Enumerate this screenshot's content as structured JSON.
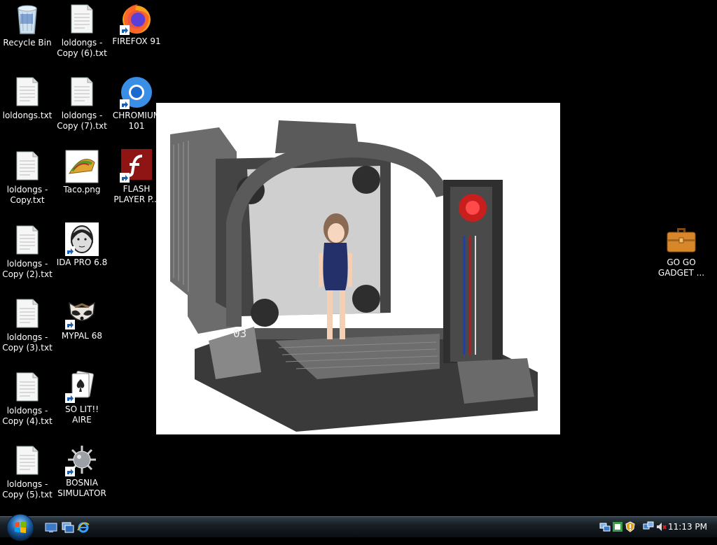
{
  "desktop_icons": [
    {
      "id": "recycle-bin",
      "label": "Recycle Bin",
      "icon": "recycle-bin-icon",
      "shortcut": false
    },
    {
      "id": "loldongs-copy6",
      "label": "loldongs -\nCopy (6).txt",
      "icon": "text-file-icon",
      "shortcut": false
    },
    {
      "id": "firefox",
      "label": "FIREFOX 91",
      "icon": "firefox-icon",
      "shortcut": true
    },
    {
      "id": "loldongs",
      "label": "loldongs.txt",
      "icon": "text-file-icon",
      "shortcut": false
    },
    {
      "id": "loldongs-copy7",
      "label": "loldongs -\nCopy (7).txt",
      "icon": "text-file-icon",
      "shortcut": false
    },
    {
      "id": "chromium",
      "label": "CHROMIUM\n101",
      "icon": "chromium-icon",
      "shortcut": true
    },
    {
      "id": "loldongs-copy",
      "label": "loldongs -\nCopy.txt",
      "icon": "text-file-icon",
      "shortcut": false
    },
    {
      "id": "taco",
      "label": "Taco.png",
      "icon": "taco-image-icon",
      "shortcut": false
    },
    {
      "id": "flash",
      "label": "FLASH\nPLAYER P...",
      "icon": "flash-player-icon",
      "shortcut": true
    },
    {
      "id": "loldongs-copy2",
      "label": "loldongs -\nCopy (2).txt",
      "icon": "text-file-icon",
      "shortcut": false
    },
    {
      "id": "ida",
      "label": "IDA PRO 6.8",
      "icon": "ida-pro-icon",
      "shortcut": true
    },
    {
      "id": "loldongs-copy3",
      "label": "loldongs -\nCopy (3).txt",
      "icon": "text-file-icon",
      "shortcut": false
    },
    {
      "id": "mypal",
      "label": "MYPAL 68",
      "icon": "mypal-icon",
      "shortcut": true
    },
    {
      "id": "loldongs-copy4",
      "label": "loldongs -\nCopy (4).txt",
      "icon": "text-file-icon",
      "shortcut": false
    },
    {
      "id": "solitaire",
      "label": "SO LIT!! AIRE",
      "icon": "solitaire-icon",
      "shortcut": true
    },
    {
      "id": "loldongs-copy5",
      "label": "loldongs -\nCopy (5).txt",
      "icon": "text-file-icon",
      "shortcut": false
    },
    {
      "id": "bosnia",
      "label": "BOSNIA\nSIMULATOR",
      "icon": "spiked-mine-icon",
      "shortcut": true
    },
    {
      "id": "gogogadget",
      "label": "GO GO\nGADGET ...",
      "icon": "briefcase-icon",
      "shortcut": false
    }
  ],
  "taskbar": {
    "start_icon": "windows-start-orb-icon",
    "quick_launch": [
      "show-desktop-icon",
      "switch-windows-icon",
      "internet-explorer-icon"
    ],
    "tray_icons": [
      "network-icon",
      "windows-update-icon",
      "security-alert-icon",
      "network-connection-icon",
      "volume-muted-icon"
    ],
    "clock": "11:13 PM"
  },
  "wallpaper_image": {
    "station_text": "03"
  }
}
